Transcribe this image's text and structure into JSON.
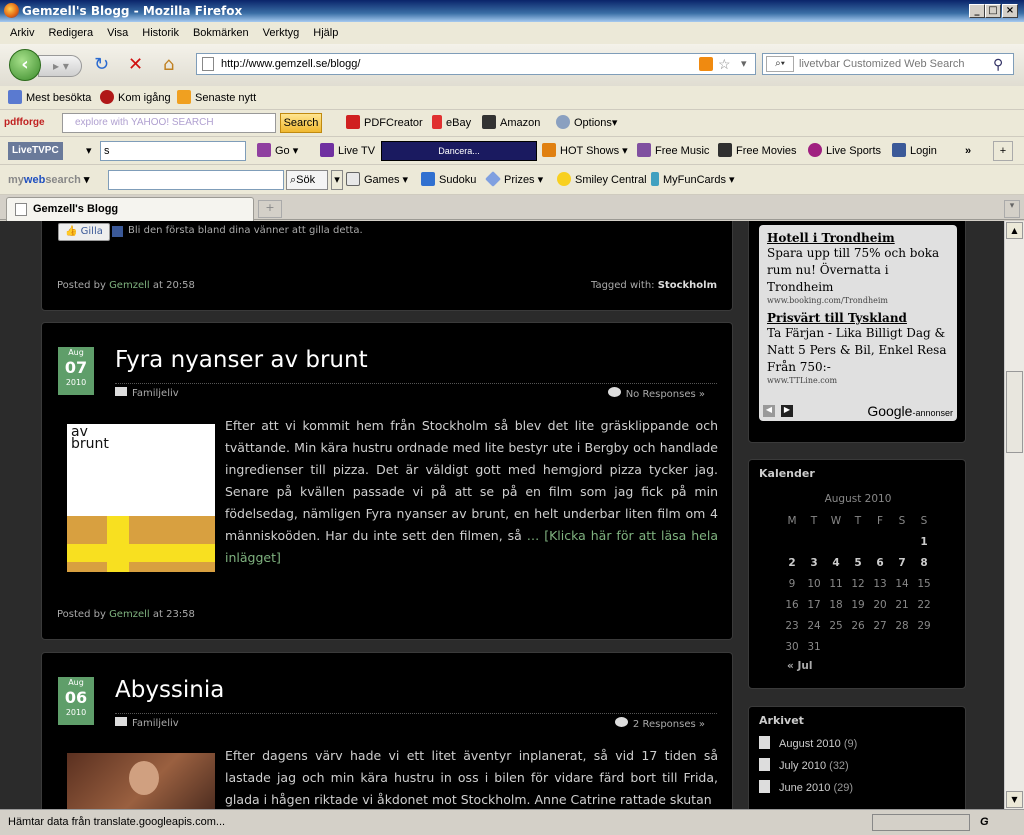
{
  "window": {
    "title": "Gemzell's Blogg - Mozilla Firefox"
  },
  "menu": [
    "Arkiv",
    "Redigera",
    "Visa",
    "Historik",
    "Bokmärken",
    "Verktyg",
    "Hjälp"
  ],
  "nav": {
    "url": "http://www.gemzell.se/blogg/",
    "search_placeholder": "livetvbar Customized Web Search"
  },
  "bookmarks": [
    "Mest besökta",
    "Kom igång",
    "Senaste nytt"
  ],
  "pdfforge": {
    "logo": "pdfforge",
    "search_placeholder": "explore with YAHOO! SEARCH",
    "search_btn": "Search",
    "items": [
      "PDFCreator",
      "eBay",
      "Amazon",
      "Options"
    ]
  },
  "livetv": {
    "logo": "LiveTVPC",
    "input": "s",
    "go": "Go",
    "live_tv": "Live TV",
    "station": "Dancera...",
    "items": [
      "HOT Shows",
      "Free Music",
      "Free Movies",
      "Live Sports",
      "Login"
    ],
    "more": "»"
  },
  "mywebsearch": {
    "logo_a": "my",
    "logo_b": "web",
    "logo_c": "search",
    "sok": "Sök",
    "items": [
      "Games",
      "Sudoku",
      "Prizes",
      "Smiley Central",
      "MyFunCards"
    ]
  },
  "tab": {
    "label": "Gemzell's Blogg"
  },
  "posts": [
    {
      "like": "Gilla",
      "like_text": "Bli den första bland dina vänner att gilla detta.",
      "posted_by": "Posted by",
      "author": "Gemzell",
      "at": "at 20:58",
      "tagged": "Tagged with:",
      "tag": "Stockholm"
    },
    {
      "month": "Aug",
      "day": "07",
      "year": "2010",
      "title": "Fyra nyanser av brunt",
      "category": "Familjeliv",
      "responses": "No Responses »",
      "thumb_text_a": "av",
      "thumb_text_b": "brunt",
      "text": "Efter att vi kommit hem från Stockholm så blev det lite gräsklippande och tvättande. Min kära hustru ordnade med lite bestyr ute i Bergby och handlade ingredienser till pizza. Det är väldigt gott med hemgjord pizza tycker jag. Senare på kvällen passade vi på att se på en film som jag fick på min födelsedag, nämligen Fyra nyanser av brunt, en helt underbar liten film om 4 människoöden. Har du inte sett den filmen, så",
      "read_more": "… [Klicka här för att läsa hela inlägget]",
      "posted_by": "Posted by",
      "author": "Gemzell",
      "at": "at 23:58"
    },
    {
      "month": "Aug",
      "day": "06",
      "year": "2010",
      "title": "Abyssinia",
      "category": "Familjeliv",
      "responses": "2 Responses »",
      "text": "Efter dagens värv hade vi ett litet äventyr inplanerat, så vid 17 tiden så lastade jag och min kära hustru in oss i bilen för vidare färd bort till Frida, glada i hågen riktade vi åkdonet mot Stockholm. Anne Catrine rattade skutan"
    }
  ],
  "ads": [
    {
      "title": "Hotell i Trondheim",
      "text": "Spara upp till 75% och boka rum nu! Övernatta i Trondheim",
      "url": "www.booking.com/Trondheim"
    },
    {
      "title": "Prisvärt till Tyskland",
      "text": "Ta Färjan - Lika Billigt Dag & Natt 5 Pers & Bil, Enkel Resa Från 750:-",
      "url": "www.TTLine.com"
    }
  ],
  "ads_footer": {
    "brand": "Google",
    "suffix": "-annonser"
  },
  "calendar": {
    "title": "Kalender",
    "month": "August 2010",
    "weekdays": [
      "M",
      "T",
      "W",
      "T",
      "F",
      "S",
      "S"
    ],
    "weeks": [
      [
        "",
        "",
        "",
        "",
        "",
        "",
        "1"
      ],
      [
        "2",
        "3",
        "4",
        "5",
        "6",
        "7",
        "8"
      ],
      [
        "9",
        "10",
        "11",
        "12",
        "13",
        "14",
        "15"
      ],
      [
        "16",
        "17",
        "18",
        "19",
        "20",
        "21",
        "22"
      ],
      [
        "23",
        "24",
        "25",
        "26",
        "27",
        "28",
        "29"
      ],
      [
        "30",
        "31",
        "",
        "",
        "",
        "",
        ""
      ]
    ],
    "bold_days": [
      "1",
      "2",
      "3",
      "4",
      "5",
      "6",
      "7",
      "8"
    ],
    "prev": "« Jul"
  },
  "archive": {
    "title": "Arkivet",
    "items": [
      {
        "label": "August 2010",
        "count": "(9)"
      },
      {
        "label": "July 2010",
        "count": "(32)"
      },
      {
        "label": "June 2010",
        "count": "(29)"
      }
    ]
  },
  "status": "Hämtar data från translate.googleapis.com..."
}
